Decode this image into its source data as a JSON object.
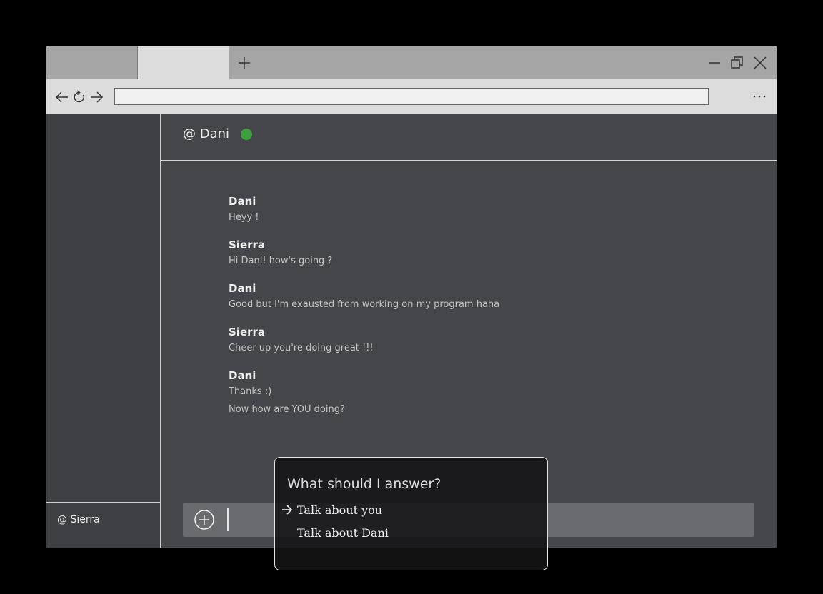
{
  "browser": {
    "tabs": [
      {
        "label": ""
      },
      {
        "label": ""
      }
    ],
    "address_value": "",
    "icons": [
      "new-tab-icon",
      "minimize-icon",
      "restore-icon",
      "close-icon",
      "back-arrow-icon",
      "reload-icon",
      "forward-arrow-icon",
      "more-options-icon"
    ]
  },
  "sidebar": {
    "current_user": "@ Sierra"
  },
  "chat": {
    "title": "@ Dani",
    "status_color": "#3f9e3f",
    "messages": [
      {
        "author": "Dani",
        "lines": [
          "Heyy !"
        ]
      },
      {
        "author": "Sierra",
        "lines": [
          "Hi Dani! how's going ?"
        ]
      },
      {
        "author": "Dani",
        "lines": [
          "Good but I'm exausted from working on my program haha"
        ]
      },
      {
        "author": "Sierra",
        "lines": [
          "Cheer up you're doing great !!!"
        ]
      },
      {
        "author": "Dani",
        "lines": [
          "Thanks :)",
          "Now how are YOU doing?"
        ]
      }
    ],
    "composer": {
      "value": "",
      "attach_icon": "plus-circle-icon"
    }
  },
  "dialog": {
    "title": "What should I answer?",
    "options": [
      {
        "label": "Talk about you",
        "selected": true
      },
      {
        "label": "Talk about Dani",
        "selected": false
      }
    ]
  }
}
